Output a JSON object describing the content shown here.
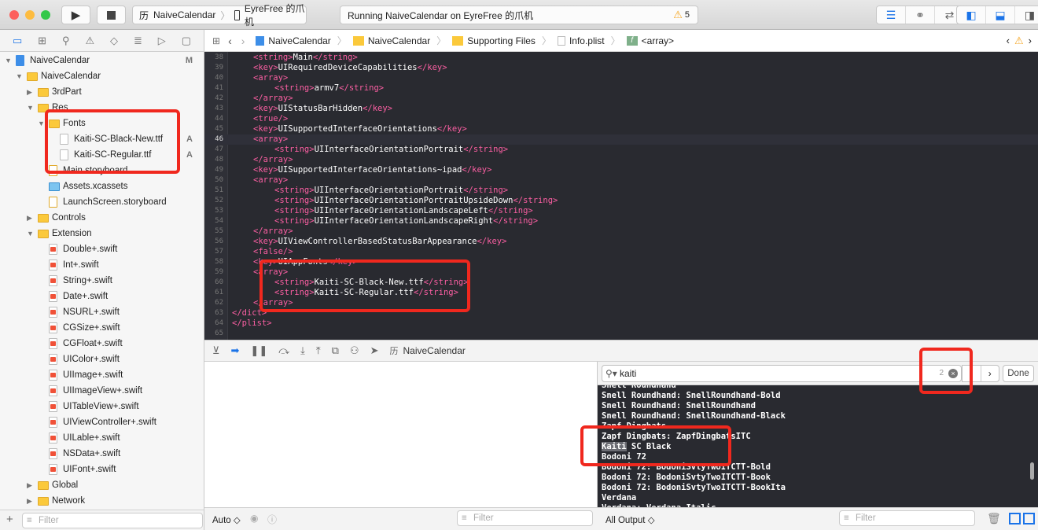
{
  "toolbar": {
    "scheme": "NaiveCalendar",
    "device": "EyreFree 的爪机",
    "activity": "Running NaiveCalendar on EyreFree 的爪机",
    "warning_count": "5"
  },
  "sidebar": {
    "items": [
      {
        "label": "NaiveCalendar",
        "type": "proj",
        "depth": 0,
        "arrow": "down",
        "badge": "M"
      },
      {
        "label": "NaiveCalendar",
        "type": "folder",
        "depth": 1,
        "arrow": "down"
      },
      {
        "label": "3rdPart",
        "type": "folder",
        "depth": 2,
        "arrow": "right"
      },
      {
        "label": "Res",
        "type": "folder",
        "depth": 2,
        "arrow": "down"
      },
      {
        "label": "Fonts",
        "type": "folder",
        "depth": 3,
        "arrow": "down"
      },
      {
        "label": "Kaiti-SC-Black-New.ttf",
        "type": "ttf",
        "depth": 4,
        "badge": "A"
      },
      {
        "label": "Kaiti-SC-Regular.ttf",
        "type": "ttf",
        "depth": 4,
        "badge": "A"
      },
      {
        "label": "Main.storyboard",
        "type": "sb",
        "depth": 3
      },
      {
        "label": "Assets.xcassets",
        "type": "xc",
        "depth": 3
      },
      {
        "label": "LaunchScreen.storyboard",
        "type": "sb",
        "depth": 3
      },
      {
        "label": "Controls",
        "type": "folder",
        "depth": 2,
        "arrow": "right"
      },
      {
        "label": "Extension",
        "type": "folder",
        "depth": 2,
        "arrow": "down"
      },
      {
        "label": "Double+.swift",
        "type": "swift",
        "depth": 3
      },
      {
        "label": "Int+.swift",
        "type": "swift",
        "depth": 3
      },
      {
        "label": "String+.swift",
        "type": "swift",
        "depth": 3
      },
      {
        "label": "Date+.swift",
        "type": "swift",
        "depth": 3
      },
      {
        "label": "NSURL+.swift",
        "type": "swift",
        "depth": 3
      },
      {
        "label": "CGSize+.swift",
        "type": "swift",
        "depth": 3
      },
      {
        "label": "CGFloat+.swift",
        "type": "swift",
        "depth": 3
      },
      {
        "label": "UIColor+.swift",
        "type": "swift",
        "depth": 3
      },
      {
        "label": "UIImage+.swift",
        "type": "swift",
        "depth": 3
      },
      {
        "label": "UIImageView+.swift",
        "type": "swift",
        "depth": 3
      },
      {
        "label": "UITableView+.swift",
        "type": "swift",
        "depth": 3
      },
      {
        "label": "UIViewController+.swift",
        "type": "swift",
        "depth": 3
      },
      {
        "label": "UILable+.swift",
        "type": "swift",
        "depth": 3
      },
      {
        "label": "NSData+.swift",
        "type": "swift",
        "depth": 3
      },
      {
        "label": "UIFont+.swift",
        "type": "swift",
        "depth": 3
      },
      {
        "label": "Global",
        "type": "folder",
        "depth": 2,
        "arrow": "right"
      },
      {
        "label": "Network",
        "type": "folder",
        "depth": 2,
        "arrow": "right"
      }
    ],
    "filter_placeholder": "Filter"
  },
  "jumpbar": {
    "crumbs": [
      "NaiveCalendar",
      "NaiveCalendar",
      "Supporting Files",
      "Info.plist",
      "<array>"
    ]
  },
  "editor": {
    "current_line": 46,
    "lines": [
      {
        "n": "38",
        "i": 1,
        "s": [
          [
            "tag",
            "<string>"
          ],
          [
            "txt",
            "Main"
          ],
          [
            "tag",
            "</string>"
          ]
        ]
      },
      {
        "n": "39",
        "i": 1,
        "s": [
          [
            "tag",
            "<key>"
          ],
          [
            "txt",
            "UIRequiredDeviceCapabilities"
          ],
          [
            "tag",
            "</key>"
          ]
        ]
      },
      {
        "n": "40",
        "i": 1,
        "s": [
          [
            "tag",
            "<array>"
          ]
        ]
      },
      {
        "n": "41",
        "i": 2,
        "s": [
          [
            "tag",
            "<string>"
          ],
          [
            "txt",
            "armv7"
          ],
          [
            "tag",
            "</string>"
          ]
        ]
      },
      {
        "n": "42",
        "i": 1,
        "s": [
          [
            "tag",
            "</array>"
          ]
        ]
      },
      {
        "n": "43",
        "i": 1,
        "s": [
          [
            "tag",
            "<key>"
          ],
          [
            "txt",
            "UIStatusBarHidden"
          ],
          [
            "tag",
            "</key>"
          ]
        ]
      },
      {
        "n": "44",
        "i": 1,
        "s": [
          [
            "tag",
            "<true/>"
          ]
        ]
      },
      {
        "n": "45",
        "i": 1,
        "s": [
          [
            "tag",
            "<key>"
          ],
          [
            "txt",
            "UISupportedInterfaceOrientations"
          ],
          [
            "tag",
            "</key>"
          ]
        ]
      },
      {
        "n": "46",
        "i": 1,
        "s": [
          [
            "tag",
            "<array>"
          ]
        ]
      },
      {
        "n": "47",
        "i": 2,
        "s": [
          [
            "tag",
            "<string>"
          ],
          [
            "txt",
            "UIInterfaceOrientationPortrait"
          ],
          [
            "tag",
            "</string>"
          ]
        ]
      },
      {
        "n": "48",
        "i": 1,
        "s": [
          [
            "tag",
            "</array>"
          ]
        ]
      },
      {
        "n": "49",
        "i": 1,
        "s": [
          [
            "tag",
            "<key>"
          ],
          [
            "txt",
            "UISupportedInterfaceOrientations~ipad"
          ],
          [
            "tag",
            "</key>"
          ]
        ]
      },
      {
        "n": "50",
        "i": 1,
        "s": [
          [
            "tag",
            "<array>"
          ]
        ]
      },
      {
        "n": "51",
        "i": 2,
        "s": [
          [
            "tag",
            "<string>"
          ],
          [
            "txt",
            "UIInterfaceOrientationPortrait"
          ],
          [
            "tag",
            "</string>"
          ]
        ]
      },
      {
        "n": "52",
        "i": 2,
        "s": [
          [
            "tag",
            "<string>"
          ],
          [
            "txt",
            "UIInterfaceOrientationPortraitUpsideDown"
          ],
          [
            "tag",
            "</string>"
          ]
        ]
      },
      {
        "n": "53",
        "i": 2,
        "s": [
          [
            "tag",
            "<string>"
          ],
          [
            "txt",
            "UIInterfaceOrientationLandscapeLeft"
          ],
          [
            "tag",
            "</string>"
          ]
        ]
      },
      {
        "n": "54",
        "i": 2,
        "s": [
          [
            "tag",
            "<string>"
          ],
          [
            "txt",
            "UIInterfaceOrientationLandscapeRight"
          ],
          [
            "tag",
            "</string>"
          ]
        ]
      },
      {
        "n": "55",
        "i": 1,
        "s": [
          [
            "tag",
            "</array>"
          ]
        ]
      },
      {
        "n": "56",
        "i": 1,
        "s": [
          [
            "tag",
            "<key>"
          ],
          [
            "txt",
            "UIViewControllerBasedStatusBarAppearance"
          ],
          [
            "tag",
            "</key>"
          ]
        ]
      },
      {
        "n": "57",
        "i": 1,
        "s": [
          [
            "tag",
            "<false/>"
          ]
        ]
      },
      {
        "n": "58",
        "i": 1,
        "s": [
          [
            "tag",
            "<key>"
          ],
          [
            "txt",
            "UIAppFonts"
          ],
          [
            "tag",
            "</key>"
          ]
        ]
      },
      {
        "n": "59",
        "i": 1,
        "s": [
          [
            "tag",
            "<array>"
          ]
        ]
      },
      {
        "n": "60",
        "i": 2,
        "s": [
          [
            "tag",
            "<string>"
          ],
          [
            "txt",
            "Kaiti-SC-Black-New.ttf"
          ],
          [
            "tag",
            "</string>"
          ]
        ]
      },
      {
        "n": "61",
        "i": 2,
        "s": [
          [
            "tag",
            "<string>"
          ],
          [
            "txt",
            "Kaiti-SC-Regular.ttf"
          ],
          [
            "tag",
            "</string>"
          ]
        ]
      },
      {
        "n": "62",
        "i": 1,
        "s": [
          [
            "tag",
            "</array>"
          ]
        ]
      },
      {
        "n": "63",
        "i": 0,
        "s": [
          [
            "tag",
            "</dict>"
          ]
        ]
      },
      {
        "n": "64",
        "i": 0,
        "s": [
          [
            "tag",
            "</plist>"
          ]
        ]
      },
      {
        "n": "65",
        "i": 0,
        "s": []
      }
    ]
  },
  "debugbar": {
    "target": "NaiveCalendar"
  },
  "console": {
    "search_value": "kaiti",
    "match_count": "2",
    "done_label": "Done",
    "lines": [
      "Snell Roundhand",
      "Snell Roundhand: SnellRoundhand-Bold",
      "Snell Roundhand: SnellRoundhand",
      "Snell Roundhand: SnellRoundhand-Black",
      "Zapf Dingbats",
      "Zapf Dingbats: ZapfDingbatsITC",
      "Kaiti SC Black",
      "Bodoni 72",
      "Bodoni 72: BodoniSvtyTwoITCTT-Bold",
      "Bodoni 72: BodoniSvtyTwoITCTT-Book",
      "Bodoni 72: BodoniSvtyTwoITCTT-BookIta",
      "Verdana",
      "Verdana: Verdana-Italic"
    ],
    "highlight": "Kaiti"
  },
  "bottom": {
    "auto_label": "Auto ◇",
    "vars_filter_placeholder": "Filter",
    "output_select": "All Output ◇",
    "console_filter_placeholder": "Filter"
  },
  "colors": {
    "tag": "#fc5fa3",
    "annotation": "#f0281e",
    "accent": "#1a73e8"
  }
}
